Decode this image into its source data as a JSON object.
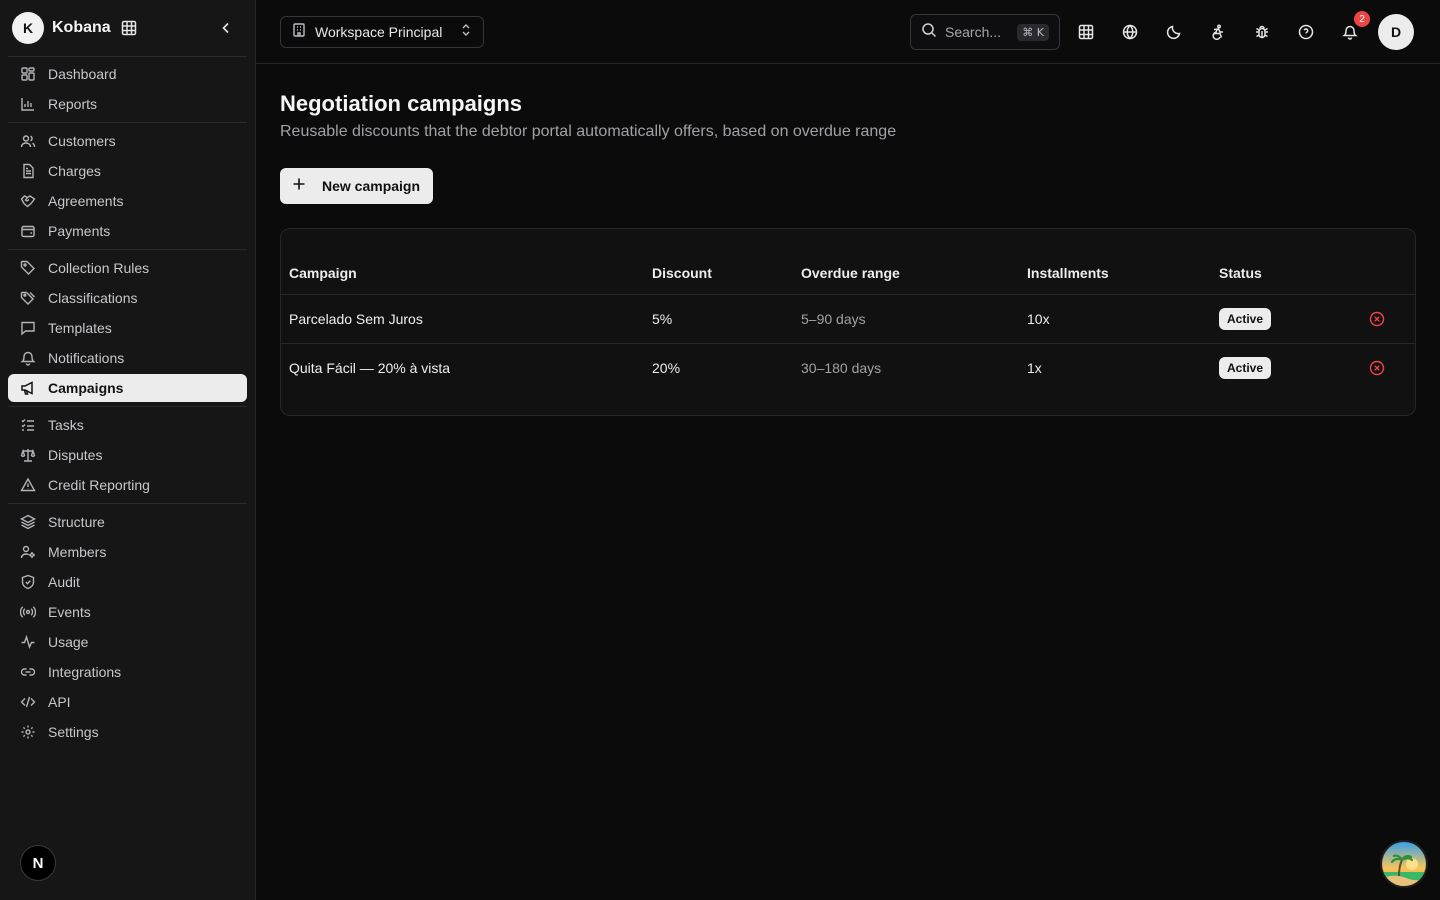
{
  "brand": {
    "initial": "K",
    "name": "Kobana"
  },
  "sidebar": {
    "groups": [
      [
        {
          "label": "Dashboard",
          "icon": "dashboard-icon"
        },
        {
          "label": "Reports",
          "icon": "bar-chart-icon"
        }
      ],
      [
        {
          "label": "Customers",
          "icon": "users-icon"
        },
        {
          "label": "Charges",
          "icon": "document-icon"
        },
        {
          "label": "Agreements",
          "icon": "handshake-icon"
        },
        {
          "label": "Payments",
          "icon": "wallet-icon"
        }
      ],
      [
        {
          "label": "Collection Rules",
          "icon": "tag-icon"
        },
        {
          "label": "Classifications",
          "icon": "tags-icon"
        },
        {
          "label": "Templates",
          "icon": "message-square-icon"
        },
        {
          "label": "Notifications",
          "icon": "bell-icon"
        },
        {
          "label": "Campaigns",
          "icon": "megaphone-icon",
          "active": true
        }
      ],
      [
        {
          "label": "Tasks",
          "icon": "list-checks-icon"
        },
        {
          "label": "Disputes",
          "icon": "scale-icon"
        },
        {
          "label": "Credit Reporting",
          "icon": "alert-triangle-icon"
        }
      ],
      [
        {
          "label": "Structure",
          "icon": "layers-icon"
        },
        {
          "label": "Members",
          "icon": "members-icon"
        },
        {
          "label": "Audit",
          "icon": "shield-icon"
        },
        {
          "label": "Events",
          "icon": "radio-icon"
        },
        {
          "label": "Usage",
          "icon": "activity-icon"
        },
        {
          "label": "Integrations",
          "icon": "link-icon"
        },
        {
          "label": "API",
          "icon": "code-icon"
        },
        {
          "label": "Settings",
          "icon": "gear-icon"
        }
      ]
    ],
    "bottom_initial": "N"
  },
  "topbar": {
    "workspace_label": "Workspace Principal",
    "search_placeholder": "Search...",
    "search_shortcut": "⌘ K",
    "notification_count": "2",
    "user_initial": "D"
  },
  "main": {
    "title": "Negotiation campaigns",
    "subtitle": "Reusable discounts that the debtor portal automatically offers, based on overdue range",
    "new_button_label": "New campaign",
    "table": {
      "headers": [
        "Campaign",
        "Discount",
        "Overdue range",
        "Installments",
        "Status"
      ],
      "rows": [
        {
          "campaign": "Parcelado Sem Juros",
          "discount": "5%",
          "range": "5–90 days",
          "installments": "10x",
          "status": "Active"
        },
        {
          "campaign": "Quita Fácil — 20% à vista",
          "discount": "20%",
          "range": "30–180 days",
          "installments": "1x",
          "status": "Active"
        }
      ]
    }
  },
  "colors": {
    "accent": "#ececec",
    "danger": "#ef4444",
    "background": "#0b0b0c",
    "sidebar": "#161617"
  }
}
